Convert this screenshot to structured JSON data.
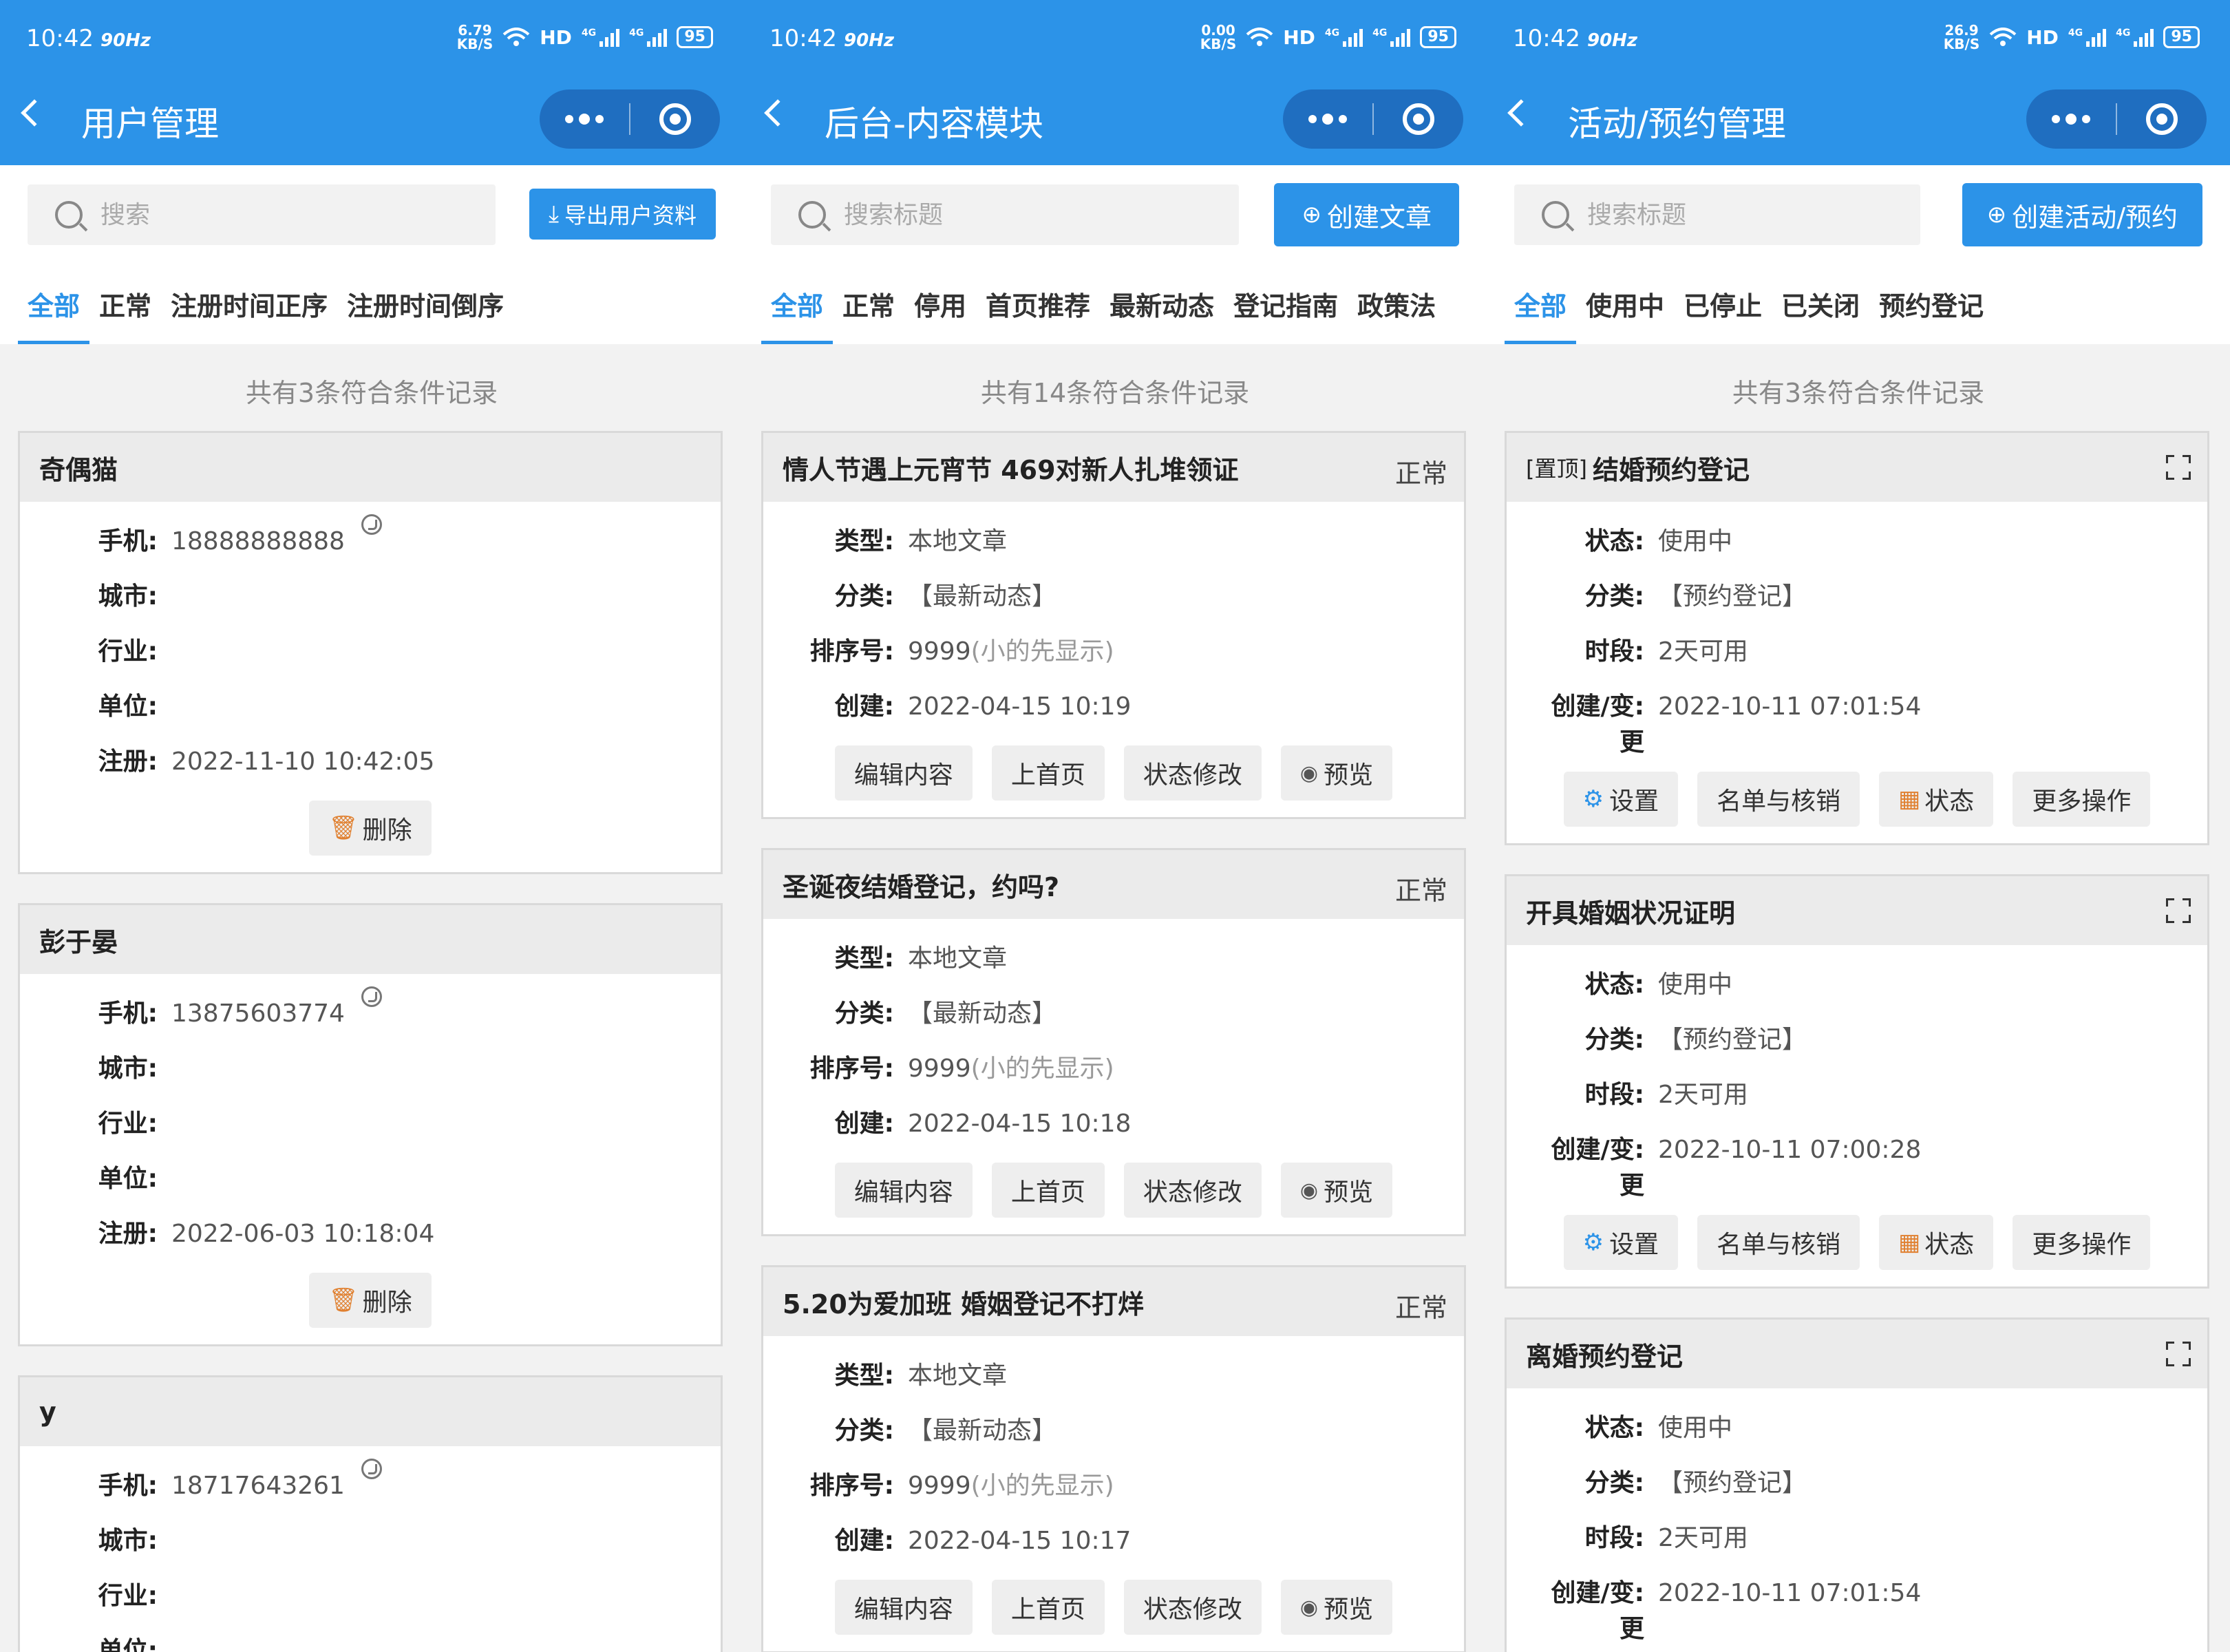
{
  "status_bar": {
    "time": "10:42",
    "hz": "90Hz",
    "speeds": [
      "6.79",
      "0.00",
      "26.9"
    ],
    "speed_unit": "KB/S",
    "hd": "HD",
    "net": "4G",
    "battery": "95"
  },
  "panel1": {
    "title": "用户管理",
    "search_placeholder": "搜索",
    "action_label": "导出用户资料",
    "tabs": [
      "全部",
      "正常",
      "注册时间正序",
      "注册时间倒序"
    ],
    "count": "共有3条符合条件记录",
    "labels": {
      "phone": "手机:",
      "city": "城市:",
      "industry": "行业:",
      "unit": "单位:",
      "register": "注册:"
    },
    "delete_label": "删除",
    "users": [
      {
        "name": "奇偶猫",
        "phone": "18888888888",
        "register": "2022-11-10 10:42:05"
      },
      {
        "name": "彭于晏",
        "phone": "13875603774",
        "register": "2022-06-03 10:18:04"
      },
      {
        "name": "y",
        "phone": "18717643261"
      }
    ]
  },
  "panel2": {
    "title": "后台-内容模块",
    "search_placeholder": "搜索标题",
    "action_label": "创建文章",
    "tabs": [
      "全部",
      "正常",
      "停用",
      "首页推荐",
      "最新动态",
      "登记指南",
      "政策法"
    ],
    "count": "共有14条符合条件记录",
    "labels": {
      "type": "类型:",
      "category": "分类:",
      "sort": "排序号:",
      "created": "创建:"
    },
    "buttons": {
      "edit": "编辑内容",
      "home": "上首页",
      "status": "状态修改",
      "preview": "预览"
    },
    "articles": [
      {
        "title": "情人节遇上元宵节 469对新人扎堆领证",
        "status": "正常",
        "type": "本地文章",
        "category": "【最新动态】",
        "sort": "9999",
        "sort_hint": "(小的先显示)",
        "created": "2022-04-15 10:19"
      },
      {
        "title": "圣诞夜结婚登记，约吗?",
        "status": "正常",
        "type": "本地文章",
        "category": "【最新动态】",
        "sort": "9999",
        "sort_hint": "(小的先显示)",
        "created": "2022-04-15 10:18"
      },
      {
        "title": "5.20为爱加班 婚姻登记不打烊",
        "status": "正常",
        "type": "本地文章",
        "category": "【最新动态】",
        "sort": "9999",
        "sort_hint": "(小的先显示)",
        "created": "2022-04-15 10:17"
      }
    ]
  },
  "panel3": {
    "title": "活动/预约管理",
    "search_placeholder": "搜索标题",
    "action_label": "创建活动/预约",
    "tabs": [
      "全部",
      "使用中",
      "已停止",
      "已关闭",
      "预约登记"
    ],
    "count": "共有3条符合条件记录",
    "labels": {
      "state": "状态:",
      "category": "分类:",
      "period": "时段:",
      "created_a": "创建/变:",
      "created_b": "更"
    },
    "buttons": {
      "settings": "设置",
      "roster": "名单与核销",
      "status": "状态",
      "more": "更多操作"
    },
    "activities": [
      {
        "tag": "[置顶]",
        "title": "结婚预约登记",
        "state": "使用中",
        "category": "【预约登记】",
        "period": "2天可用",
        "created": "2022-10-11 07:01:54"
      },
      {
        "tag": "",
        "title": "开具婚姻状况证明",
        "state": "使用中",
        "category": "【预约登记】",
        "period": "2天可用",
        "created": "2022-10-11 07:00:28"
      },
      {
        "tag": "",
        "title": "离婚预约登记",
        "state": "使用中",
        "category": "【预约登记】",
        "period": "2天可用",
        "created": "2022-10-11 07:01:54"
      }
    ]
  }
}
